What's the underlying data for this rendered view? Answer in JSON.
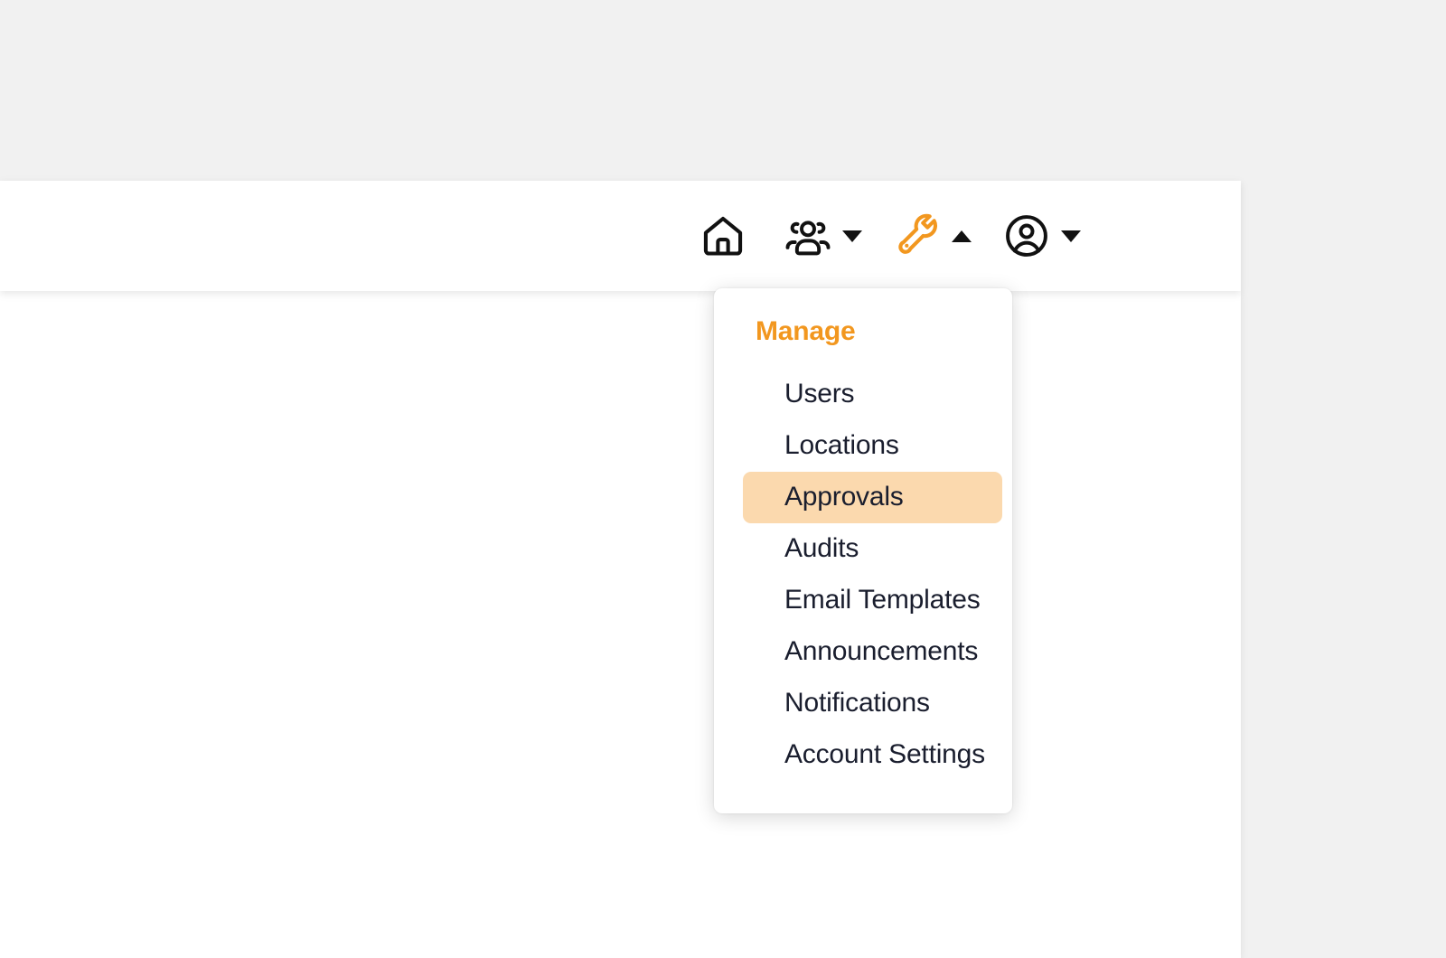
{
  "theme": {
    "page_background": "#f1f1f1",
    "surface": "#ffffff",
    "accent_orange": "#f2971f",
    "highlight_peach": "#fbd9ae",
    "text_dark": "#1a1e2e",
    "icon_dark": "#111111"
  },
  "top_nav": {
    "items": [
      {
        "icon": "home-icon",
        "label": "Home",
        "has_caret": false,
        "caret": "",
        "active": false
      },
      {
        "icon": "people-group-icon",
        "label": "People",
        "has_caret": true,
        "caret": "down",
        "active": false
      },
      {
        "icon": "wrench-icon",
        "label": "Manage",
        "has_caret": true,
        "caret": "up",
        "active": true
      },
      {
        "icon": "account-circle-icon",
        "label": "Account",
        "has_caret": true,
        "caret": "down",
        "active": false
      }
    ]
  },
  "manage_dropdown": {
    "heading": "Manage",
    "items": [
      {
        "label": "Users",
        "selected": false
      },
      {
        "label": "Locations",
        "selected": false
      },
      {
        "label": "Approvals",
        "selected": true
      },
      {
        "label": "Audits",
        "selected": false
      },
      {
        "label": "Email Templates",
        "selected": false
      },
      {
        "label": "Announcements",
        "selected": false
      },
      {
        "label": "Notifications",
        "selected": false
      },
      {
        "label": "Account Settings",
        "selected": false
      }
    ]
  }
}
